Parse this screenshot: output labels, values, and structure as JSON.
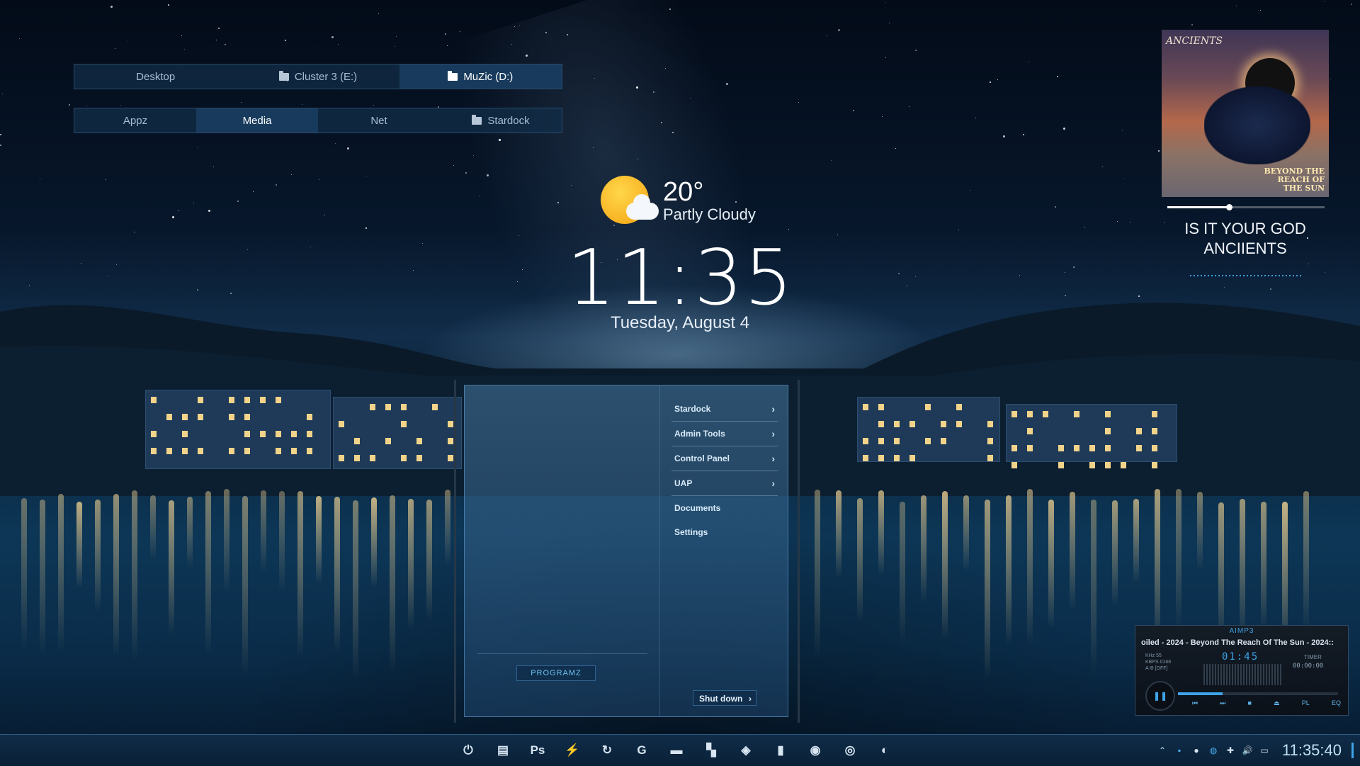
{
  "tabs_row1": [
    {
      "label": "Desktop",
      "folder": false,
      "active": false
    },
    {
      "label": "Cluster 3 (E:)",
      "folder": true,
      "active": false
    },
    {
      "label": "MuZic (D:)",
      "folder": true,
      "active": true
    }
  ],
  "tabs_row2": [
    {
      "label": "Appz",
      "folder": false,
      "active": false
    },
    {
      "label": "Media",
      "folder": false,
      "active": true
    },
    {
      "label": "Net",
      "folder": false,
      "active": false
    },
    {
      "label": "Stardock",
      "folder": true,
      "active": false
    }
  ],
  "weather": {
    "temp": "20°",
    "condition": "Partly Cloudy",
    "icon": "partly-cloudy-icon"
  },
  "clock": {
    "time": "11:35",
    "date": "Tuesday, August 4"
  },
  "now_playing": {
    "album_band_text": "ANCIENTS",
    "album_title_text": "BEYOND THE REACH OF THE SUN",
    "song": "IS IT YOUR GOD",
    "artist": "ANCIIENTS",
    "progress_fraction": 0.39
  },
  "start_menu": {
    "items": [
      {
        "label": "Stardock",
        "submenu": true
      },
      {
        "label": "Admin Tools",
        "submenu": true
      },
      {
        "label": "Control Panel",
        "submenu": true
      },
      {
        "label": "UAP",
        "submenu": true
      },
      {
        "label": "Documents",
        "submenu": false
      },
      {
        "label": "Settings",
        "submenu": false
      }
    ],
    "programs_label": "PROGRAMZ",
    "shutdown_label": "Shut down"
  },
  "aimp": {
    "title": "AIMP3",
    "track": "oiled - 2024 - Beyond The Reach Of The Sun - 2024::",
    "time": "01:45",
    "timer_label": "TIMER",
    "timer_value": "00:00:00",
    "info_lines": [
      "KHz 55",
      "KBPS 0168",
      "A-B [OFF]"
    ],
    "controls": [
      "⏮",
      "⏭",
      "■",
      "⏏",
      "PL",
      "EQ"
    ],
    "seek_fraction": 0.28
  },
  "taskbar": {
    "icons": [
      "power-icon",
      "file-manager-icon",
      "photoshop-icon",
      "lightning-icon",
      "refresh-icon",
      "g-app-icon",
      "folder-icon",
      "clapper-icon",
      "tool-icon",
      "document-icon",
      "record-icon",
      "chrome-icon",
      "firefox-icon"
    ],
    "glyphs": [
      "⏻",
      "▤",
      "Ps",
      "⚡",
      "↻",
      "G",
      "▬",
      "▚",
      "◈",
      "▮",
      "◉",
      "◎",
      "◐"
    ],
    "tray": [
      "chevron-up-icon",
      "app-tray-icon",
      "network-globe-icon",
      "steam-icon",
      "shield-icon",
      "volume-icon",
      "monitor-icon"
    ],
    "tray_glyphs": [
      "⌃",
      "▪",
      "●",
      "◍",
      "✚",
      "🔊",
      "▭"
    ],
    "clock": "11:35:40"
  },
  "colors": {
    "accent": "#3ea4e8",
    "panel": "#122d48"
  }
}
